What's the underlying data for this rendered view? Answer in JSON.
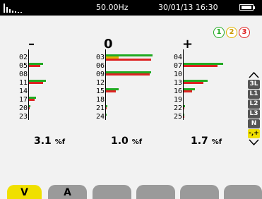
{
  "status": {
    "frequency": "50.00Hz",
    "datetime": "30/01/13 16:30"
  },
  "phases": [
    "1",
    "2",
    "3"
  ],
  "panels": [
    {
      "sign": "–",
      "labels": [
        "02",
        "05",
        "08",
        "11",
        "14",
        "17",
        "20",
        "23"
      ],
      "value": "3.1",
      "unit": "%f",
      "bars": [
        {
          "row": 1,
          "g": 20,
          "r": 16
        },
        {
          "row": 3,
          "g": 24,
          "r": 20
        },
        {
          "row": 5,
          "g": 10,
          "r": 8
        },
        {
          "row": 6,
          "g": 2,
          "r": 1
        },
        {
          "row": 8,
          "g": 1,
          "r": 1
        }
      ]
    },
    {
      "sign": "0",
      "labels": [
        "03",
        "06",
        "09",
        "12",
        "15",
        "18",
        "21",
        "24"
      ],
      "value": "1.0",
      "unit": "%f",
      "bars": [
        {
          "row": 0,
          "g": 66,
          "r": 64,
          "y": 18
        },
        {
          "row": 2,
          "g": 64,
          "r": 62
        },
        {
          "row": 4,
          "g": 18,
          "r": 14
        },
        {
          "row": 6,
          "g": 2,
          "r": 1
        },
        {
          "row": 7,
          "g": 1,
          "r": 0
        }
      ]
    },
    {
      "sign": "+",
      "labels": [
        "04",
        "07",
        "10",
        "13",
        "16",
        "19",
        "22",
        "25"
      ],
      "value": "1.7",
      "unit": "%f",
      "bars": [
        {
          "row": 1,
          "g": 56,
          "r": 48
        },
        {
          "row": 3,
          "g": 34,
          "r": 28
        },
        {
          "row": 4,
          "g": 16,
          "r": 12
        },
        {
          "row": 6,
          "g": 2,
          "r": 1
        },
        {
          "row": 7,
          "g": 1,
          "r": 1
        }
      ]
    }
  ],
  "selector": {
    "items": [
      "3L",
      "L1",
      "L2",
      "L3",
      "N",
      "-,+"
    ],
    "active": "-,+"
  },
  "tabs": {
    "v": "V",
    "a": "A"
  },
  "colors": {
    "phase1": "#22aa22",
    "phase2": "#e0b400",
    "phase3": "#dd2222",
    "active": "#f0e000"
  }
}
